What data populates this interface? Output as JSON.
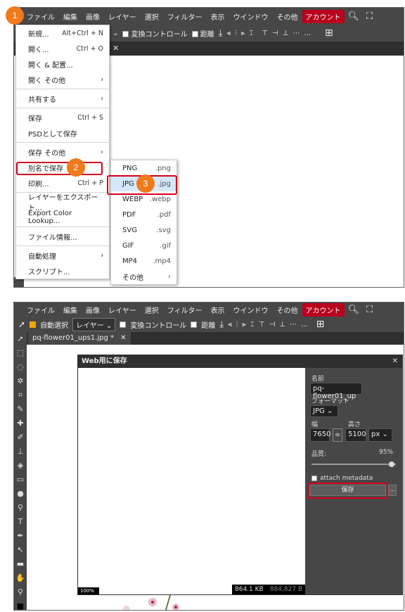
{
  "menubar": {
    "items": [
      "ファイル",
      "編集",
      "画像",
      "レイヤー",
      "選択",
      "フィルター",
      "表示",
      "ウインドウ",
      "その他"
    ],
    "account": "アカウント"
  },
  "toolbar1": {
    "transform": "変換コントロール",
    "distance": "距離",
    "more": "..."
  },
  "file_menu": [
    {
      "label": "新規...",
      "shortcut": "Alt+Ctrl + N"
    },
    {
      "label": "開く...",
      "shortcut": "Ctrl + O"
    },
    {
      "label": "開く & 配置...",
      "shortcut": ""
    },
    {
      "label": "開く その他",
      "shortcut": "›"
    },
    {
      "label": "共有する",
      "shortcut": "›"
    },
    {
      "label": "保存",
      "shortcut": "Ctrl + S"
    },
    {
      "label": "PSDとして保存",
      "shortcut": ""
    },
    {
      "label": "保存 その他",
      "shortcut": "›"
    },
    {
      "label": "別名で保存",
      "shortcut": ""
    },
    {
      "label": "印刷...",
      "shortcut": "Ctrl + P"
    },
    {
      "label": "レイヤーをエクスポート...",
      "shortcut": ""
    },
    {
      "label": "Export Color Lookup...",
      "shortcut": ""
    },
    {
      "label": "ファイル情報...",
      "shortcut": ""
    },
    {
      "label": "自動処理",
      "shortcut": "›"
    },
    {
      "label": "スクリプト...",
      "shortcut": ""
    }
  ],
  "submenu": [
    {
      "label": "PNG",
      "ext": ".png"
    },
    {
      "label": "JPG",
      "ext": ".jpg"
    },
    {
      "label": "WEBP",
      "ext": ".webp"
    },
    {
      "label": "PDF",
      "ext": ".pdf"
    },
    {
      "label": "SVG",
      "ext": ".svg"
    },
    {
      "label": "GIF",
      "ext": ".gif"
    },
    {
      "label": "MP4",
      "ext": ".mp4"
    },
    {
      "label": "その他",
      "ext": "›"
    }
  ],
  "badges": [
    "1",
    "2",
    "3"
  ],
  "panel2": {
    "autoselect": "自動選択",
    "layer_select": "レイヤー",
    "transform": "変換コントロール",
    "distance": "距離",
    "more": "...",
    "tab_name": "pq-flower01_ups1.jpg *",
    "tab_close": "✕"
  },
  "dialog": {
    "title": "Web用に保存",
    "close": "✕",
    "name_label": "名前",
    "name_value": "pq-flower01_up",
    "format_label": "フォーマット",
    "format_value": "JPG",
    "width_label": "幅",
    "height_label": "高さ",
    "width_value": "7650",
    "height_value": "5100",
    "unit": "px",
    "quality_label": "品質:",
    "quality_value": "95%",
    "quality_fraction": 0.95,
    "metadata_label": "attach metadata",
    "save_label": "保存",
    "more": "...",
    "zoom": "100%",
    "size_new": "864.1 KB",
    "size_old": "884,827 B"
  }
}
